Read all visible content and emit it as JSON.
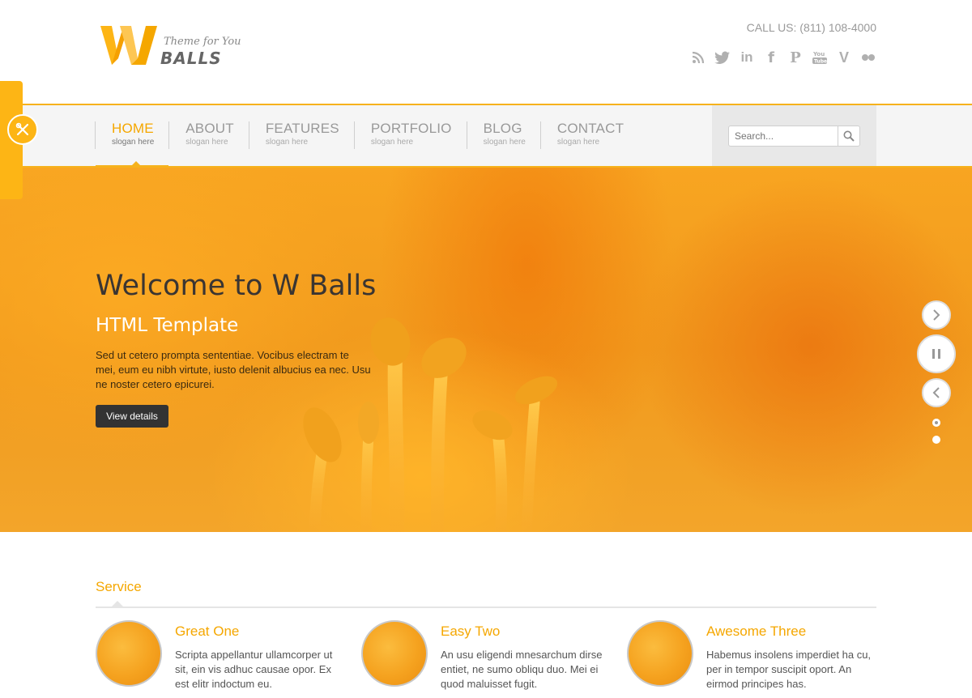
{
  "header": {
    "logo_tagline": "Theme for You",
    "logo_brand": "BALLS",
    "callus": "CALL US: (811) 108-4000",
    "social": [
      {
        "name": "rss-icon",
        "glyph": ""
      },
      {
        "name": "twitter-icon",
        "glyph": ""
      },
      {
        "name": "linkedin-icon",
        "glyph": "in"
      },
      {
        "name": "facebook-icon",
        "glyph": "f"
      },
      {
        "name": "pinterest-icon",
        "glyph": "P"
      },
      {
        "name": "youtube-icon",
        "glyph": ""
      },
      {
        "name": "vimeo-icon",
        "glyph": "V"
      },
      {
        "name": "flickr-icon",
        "glyph": ""
      }
    ]
  },
  "nav": {
    "items": [
      {
        "label": "HOME",
        "slogan": "slogan here"
      },
      {
        "label": "ABOUT",
        "slogan": "slogan here"
      },
      {
        "label": "FEATURES",
        "slogan": "slogan here"
      },
      {
        "label": "PORTFOLIO",
        "slogan": "slogan here"
      },
      {
        "label": "BLOG",
        "slogan": "slogan here"
      },
      {
        "label": "CONTACT",
        "slogan": "slogan here"
      }
    ],
    "active_index": 0,
    "search_placeholder": "Search..."
  },
  "hero": {
    "title": "Welcome to W Balls",
    "subtitle": "HTML Template",
    "text": "Sed ut cetero prompta sententiae. Vocibus electram te mei, eum eu nibh virtute, iusto delenit albucius ea nec. Usu ne noster cetero epicurei.",
    "button": "View details",
    "slides_total": 2,
    "slide_active": 1
  },
  "services": {
    "title": "Service",
    "items": [
      {
        "title": "Great One",
        "text": "Scripta appellantur ullamcorper ut sit, ein vis adhuc causae opor. Ex est elitr indoctum eu."
      },
      {
        "title": "Easy Two",
        "text": "An usu eligendi mnesarchum dirse entiet, ne sumo obliqu duo. Mei ei quod maluisset fugit."
      },
      {
        "title": "Awesome Three",
        "text": "Habemus insolens imperdiet ha cu, per in tempor suscipit oport. An eirmod principes has."
      }
    ]
  },
  "colors": {
    "accent": "#f5a700",
    "accent_border": "#f6b21c",
    "hero_orange": "#f19a1d",
    "dark_button": "#333333"
  }
}
